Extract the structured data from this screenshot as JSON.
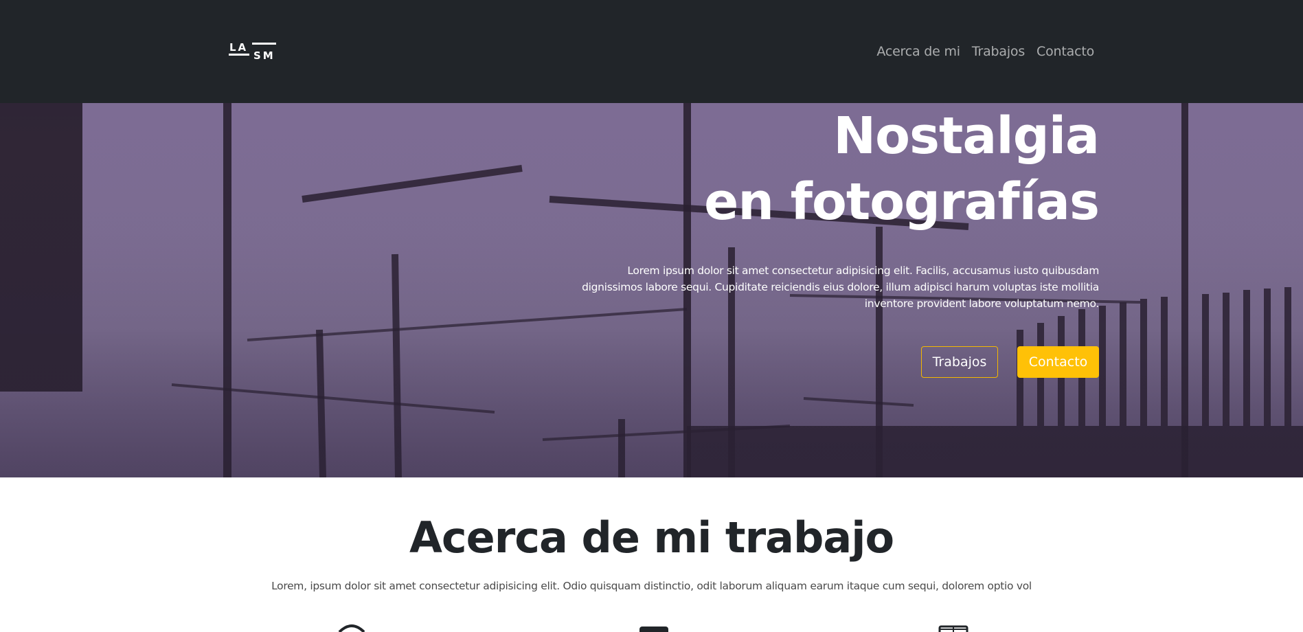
{
  "navbar": {
    "logo_text": "LASM",
    "links": [
      {
        "label": "Acerca de mi"
      },
      {
        "label": "Trabajos"
      },
      {
        "label": "Contacto"
      }
    ]
  },
  "hero": {
    "title_line1": "Nostalgia",
    "title_line2": "en fotografías",
    "text": "Lorem ipsum dolor sit amet consectetur adipisicing elit. Facilis, accusamus iusto quibusdam dignissimos labore sequi. Cupiditate reiciendis eius dolore, illum adipisci harum voluptas iste mollitia inventore provident labore voluptatum nemo.",
    "buttons": {
      "works": "Trabajos",
      "contact": "Contacto"
    },
    "image_icon": "cranes-photo"
  },
  "about": {
    "title": "Acerca de mi trabajo",
    "text": "Lorem, ipsum dolor sit amet consectetur adipisicing elit. Odio quisquam distinctio, odit laborum aliquam earum itaque cum sequi, dolorem optio vol",
    "icons": [
      "camera-icon",
      "phone-icon",
      "laptop-icon"
    ]
  },
  "colors": {
    "navbar_bg": "#212529",
    "accent": "#ffc107",
    "hero_tint": "#8a79a2"
  }
}
